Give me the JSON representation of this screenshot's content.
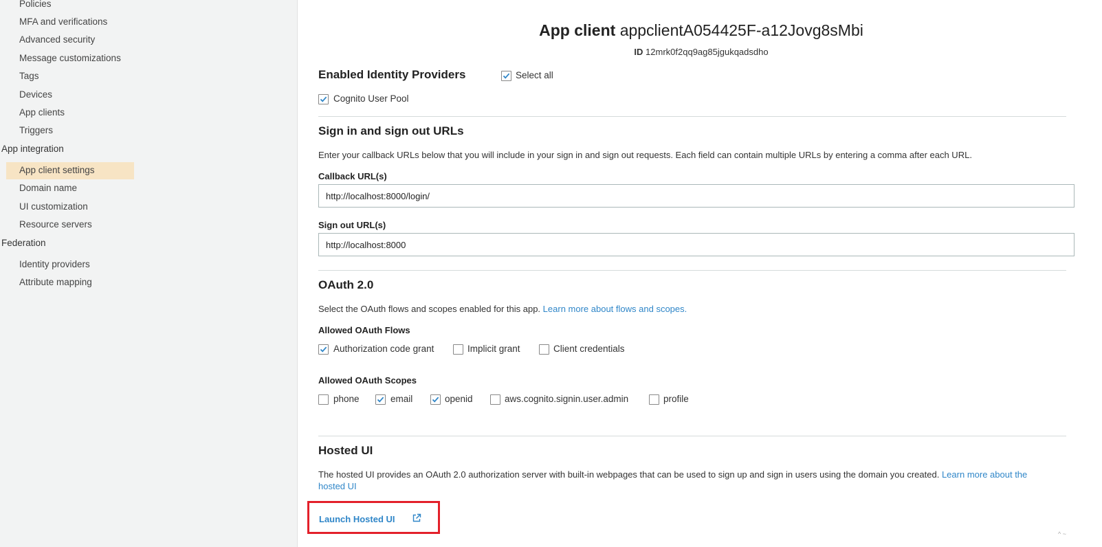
{
  "sidebar": {
    "items_top": [
      "Policies",
      "MFA and verifications",
      "Advanced security",
      "Message customizations",
      "Tags",
      "Devices",
      "App clients",
      "Triggers"
    ],
    "group_app_integration": "App integration",
    "items_app_integration": [
      "App client settings",
      "Domain name",
      "UI customization",
      "Resource servers"
    ],
    "group_federation": "Federation",
    "items_federation": [
      "Identity providers",
      "Attribute mapping"
    ]
  },
  "header": {
    "title_prefix": "App client",
    "title_name": "appclientA054425F-a12Jovg8sMbi",
    "id_label": "ID",
    "id_value": "12mrk0f2qq9ag85jgukqadsdho"
  },
  "identity_providers": {
    "title": "Enabled Identity Providers",
    "select_all_label": "Select all",
    "select_all_checked": true,
    "cognito_label": "Cognito User Pool",
    "cognito_checked": true
  },
  "urls": {
    "title": "Sign in and sign out URLs",
    "description": "Enter your callback URLs below that you will include in your sign in and sign out requests. Each field can contain multiple URLs by entering a comma after each URL.",
    "callback_label": "Callback URL(s)",
    "callback_value": "http://localhost:8000/login/",
    "signout_label": "Sign out URL(s)",
    "signout_value": "http://localhost:8000"
  },
  "oauth": {
    "title": "OAuth 2.0",
    "description": "Select the OAuth flows and scopes enabled for this app.",
    "learn_more": "Learn more about flows and scopes.",
    "flows_label": "Allowed OAuth Flows",
    "flows": [
      {
        "label": "Authorization code grant",
        "checked": true
      },
      {
        "label": "Implicit grant",
        "checked": false
      },
      {
        "label": "Client credentials",
        "checked": false
      }
    ],
    "scopes_label": "Allowed OAuth Scopes",
    "scopes": [
      {
        "label": "phone",
        "checked": false
      },
      {
        "label": "email",
        "checked": true
      },
      {
        "label": "openid",
        "checked": true
      },
      {
        "label": "aws.cognito.signin.user.admin",
        "checked": false
      },
      {
        "label": "profile",
        "checked": false
      }
    ]
  },
  "hosted_ui": {
    "title": "Hosted UI",
    "description": "The hosted UI provides an OAuth 2.0 authorization server with built-in webpages that can be used to sign up and sign in users using the domain you created.",
    "learn_more_line1": "Learn more about the",
    "learn_more_line2": "hosted UI",
    "launch_label": "Launch Hosted UI",
    "launch_icon": "external-link-icon"
  },
  "colors": {
    "link": "#2f86c8",
    "check": "#2f86c8",
    "highlight_box": "#e3202a",
    "active_nav": "#f7e4c4"
  }
}
